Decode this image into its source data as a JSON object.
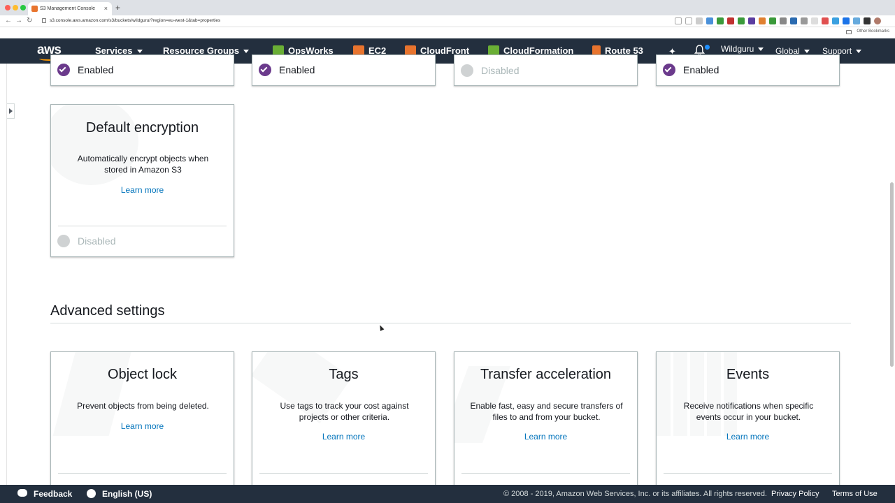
{
  "browser": {
    "tab_title": "S3 Management Console",
    "tab_close": "×",
    "new_tab": "+",
    "url": "s3.console.aws.amazon.com/s3/buckets/wildguru/?region=eu-west-1&tab=properties",
    "bookmarks_label": "Other Bookmarks",
    "back": "←",
    "forward": "→",
    "reload": "↻"
  },
  "nav": {
    "logo": "aws",
    "services": "Services",
    "resource_groups": "Resource Groups",
    "opsworks": "OpsWorks",
    "ec2": "EC2",
    "cloudfront": "CloudFront",
    "cloudformation": "CloudFormation",
    "route53": "Route 53",
    "pin": "✦",
    "account": "Wildguru",
    "region": "Global",
    "support": "Support",
    "icon_colors": {
      "opsworks": "#6aaf35",
      "ec2": "#e8742e",
      "cloudfront": "#e8742e",
      "cloudformation": "#6aaf35",
      "route53": "#e8742e"
    }
  },
  "top_row_statuses": [
    {
      "label": "Enabled",
      "state": "on"
    },
    {
      "label": "Enabled",
      "state": "on"
    },
    {
      "label": "Disabled",
      "state": "off"
    },
    {
      "label": "Enabled",
      "state": "on"
    }
  ],
  "default_encryption": {
    "title": "Default encryption",
    "description": "Automatically encrypt objects when stored in Amazon S3",
    "link": "Learn more",
    "status": "Disabled"
  },
  "advanced": {
    "title": "Advanced settings",
    "cards": [
      {
        "title": "Object lock",
        "description": "Prevent objects from being deleted.",
        "link": "Learn more"
      },
      {
        "title": "Tags",
        "description": "Use tags to track your cost against projects or other criteria.",
        "link": "Learn more"
      },
      {
        "title": "Transfer acceleration",
        "description": "Enable fast, easy and secure transfers of files to and from your bucket.",
        "link": "Learn more"
      },
      {
        "title": "Events",
        "description": "Receive notifications when specific events occur in your bucket.",
        "link": "Learn more"
      }
    ]
  },
  "footer": {
    "feedback": "Feedback",
    "language": "English (US)",
    "copyright": "© 2008 - 2019, Amazon Web Services, Inc. or its affiliates. All rights reserved.",
    "privacy": "Privacy Policy",
    "terms": "Terms of Use"
  },
  "colors": {
    "nav_bg": "#232f3e",
    "enabled": "#6b3a8c",
    "link": "#0073bb"
  }
}
